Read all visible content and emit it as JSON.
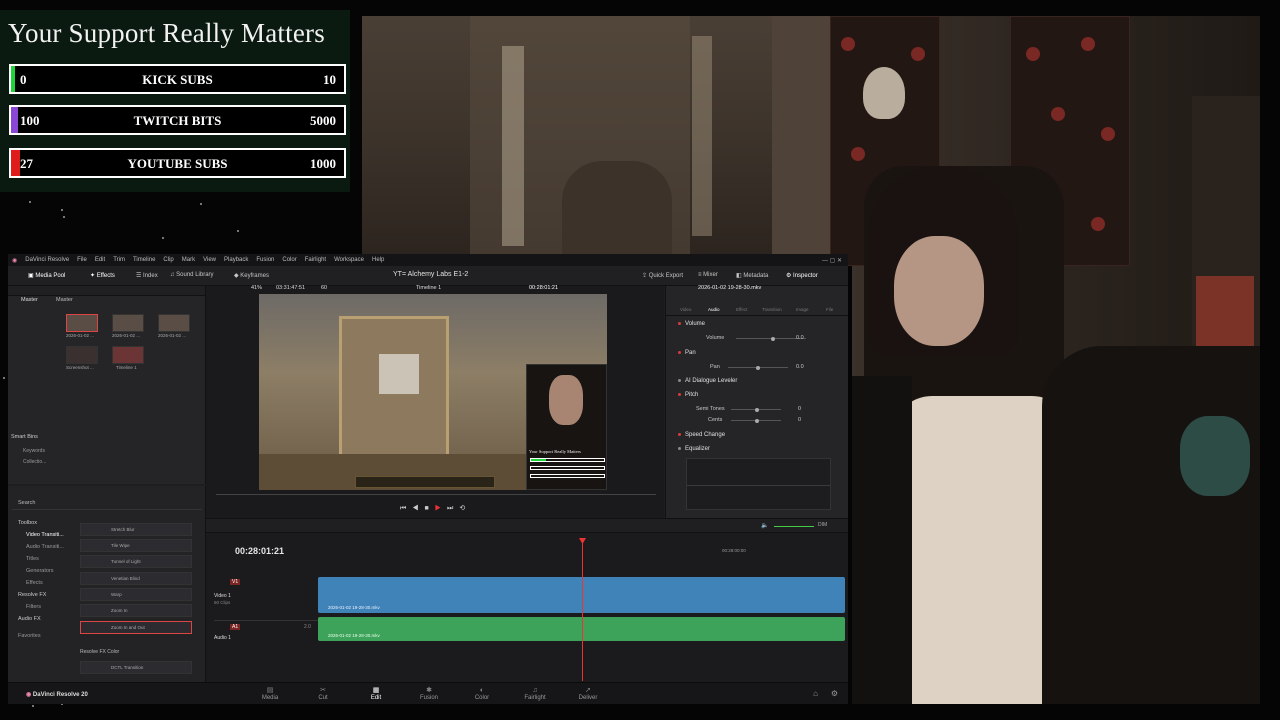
{
  "goal_overlay": {
    "title": "Your Support Really Matters",
    "bars": [
      {
        "low": "0",
        "label": "KICK SUBS",
        "high": "10",
        "progress": 0.0,
        "accent": "#1ed43a"
      },
      {
        "low": "100",
        "label": "TWITCH BITS",
        "high": "5000",
        "progress": 0.02,
        "accent": "#8a47d6"
      },
      {
        "low": "27",
        "label": "YOUTUBE SUBS",
        "high": "1000",
        "progress": 0.027,
        "accent": "#e01b1b"
      }
    ]
  },
  "resolve": {
    "app_name": "DaVinci Resolve",
    "menu": [
      "File",
      "Edit",
      "Trim",
      "Timeline",
      "Clip",
      "Mark",
      "View",
      "Playback",
      "Fusion",
      "Color",
      "Fairlight",
      "Workspace",
      "Help"
    ],
    "toolbar": {
      "media_pool": "Media Pool",
      "effects": "Effects",
      "index": "Index",
      "sound_library": "Sound Library",
      "keyframes": "Keyframes",
      "project_title": "YT= Alchemy Labs E1-2",
      "quick_export": "Quick Export",
      "mixer": "Mixer",
      "metadata": "Metadata",
      "inspector": "Inspector"
    },
    "media_pool": {
      "bin_tabs": [
        "Master",
        "Master"
      ],
      "clips": [
        "2026-01-02 ...",
        "2026-01-02 ...",
        "2026-01-02 ...",
        "Screenshot ...",
        "Timeline 1"
      ],
      "smart_bins_label": "Smart Bins",
      "smart_bins": [
        "Keywords",
        "Collectio..."
      ]
    },
    "viewer": {
      "zoom": "41%",
      "duration": "03:31:47:51",
      "fps": "60",
      "timeline_name": "Timeline 1",
      "timecode": "00:28:01:21",
      "pip_overlay_text": "Your Support Really Matters"
    },
    "inspector": {
      "clip_name": "2026-01-02 19-28-30.mkv",
      "tabs": [
        "Video",
        "Audio",
        "Effect",
        "Transition",
        "Image",
        "File"
      ],
      "active_tab": "Audio",
      "sections": {
        "volume": "Volume",
        "volume_param": "Volume",
        "volume_value": "0.0",
        "pan": "Pan",
        "pan_param": "Pan",
        "pan_value": "0.0",
        "ai_dialogue": "AI Dialogue Leveler",
        "pitch": "Pitch",
        "semi_tones": "Semi Tones",
        "semi_value": "0",
        "cents": "Cents",
        "cents_value": "0",
        "speed_change": "Speed Change",
        "equalizer": "Equalizer"
      }
    },
    "effects": {
      "search_placeholder": "Search",
      "tree": [
        "Toolbox",
        "Video Transiti...",
        "Audio Transiti...",
        "Titles",
        "Generators",
        "Effects",
        "Resolve FX",
        "Filters",
        "Audio FX",
        "Favorites"
      ],
      "items": [
        "Stretch Blur",
        "Tile Wipe",
        "Tunnel of Light",
        "Venetian Blind",
        "Warp",
        "Zoom In",
        "Zoom In and Out"
      ],
      "selected_item": "Zoom In and Out",
      "group_label": "Resolve FX Color",
      "group_item": "DCTL Transition"
    },
    "timeline": {
      "timecode": "00:28:01:21",
      "ruler_start": "01:00:00:00",
      "ruler_mid": "00:28:00:00",
      "video_track": {
        "id": "V1",
        "name": "Video 1",
        "info": "60 Clips",
        "clip": "2026-01-02 19-28-30.mkv",
        "color": "#3f83b8"
      },
      "audio_track": {
        "id": "A1",
        "name": "Audio 1",
        "channels": "2.0",
        "clip": "2026-01-02 19-28-30.mkv",
        "color": "#3da35a"
      },
      "dim_label": "DIM"
    },
    "pages": [
      "Media",
      "Cut",
      "Edit",
      "Fusion",
      "Color",
      "Fairlight",
      "Deliver"
    ],
    "active_page": "Edit",
    "brand": "DaVinci Resolve 20"
  }
}
